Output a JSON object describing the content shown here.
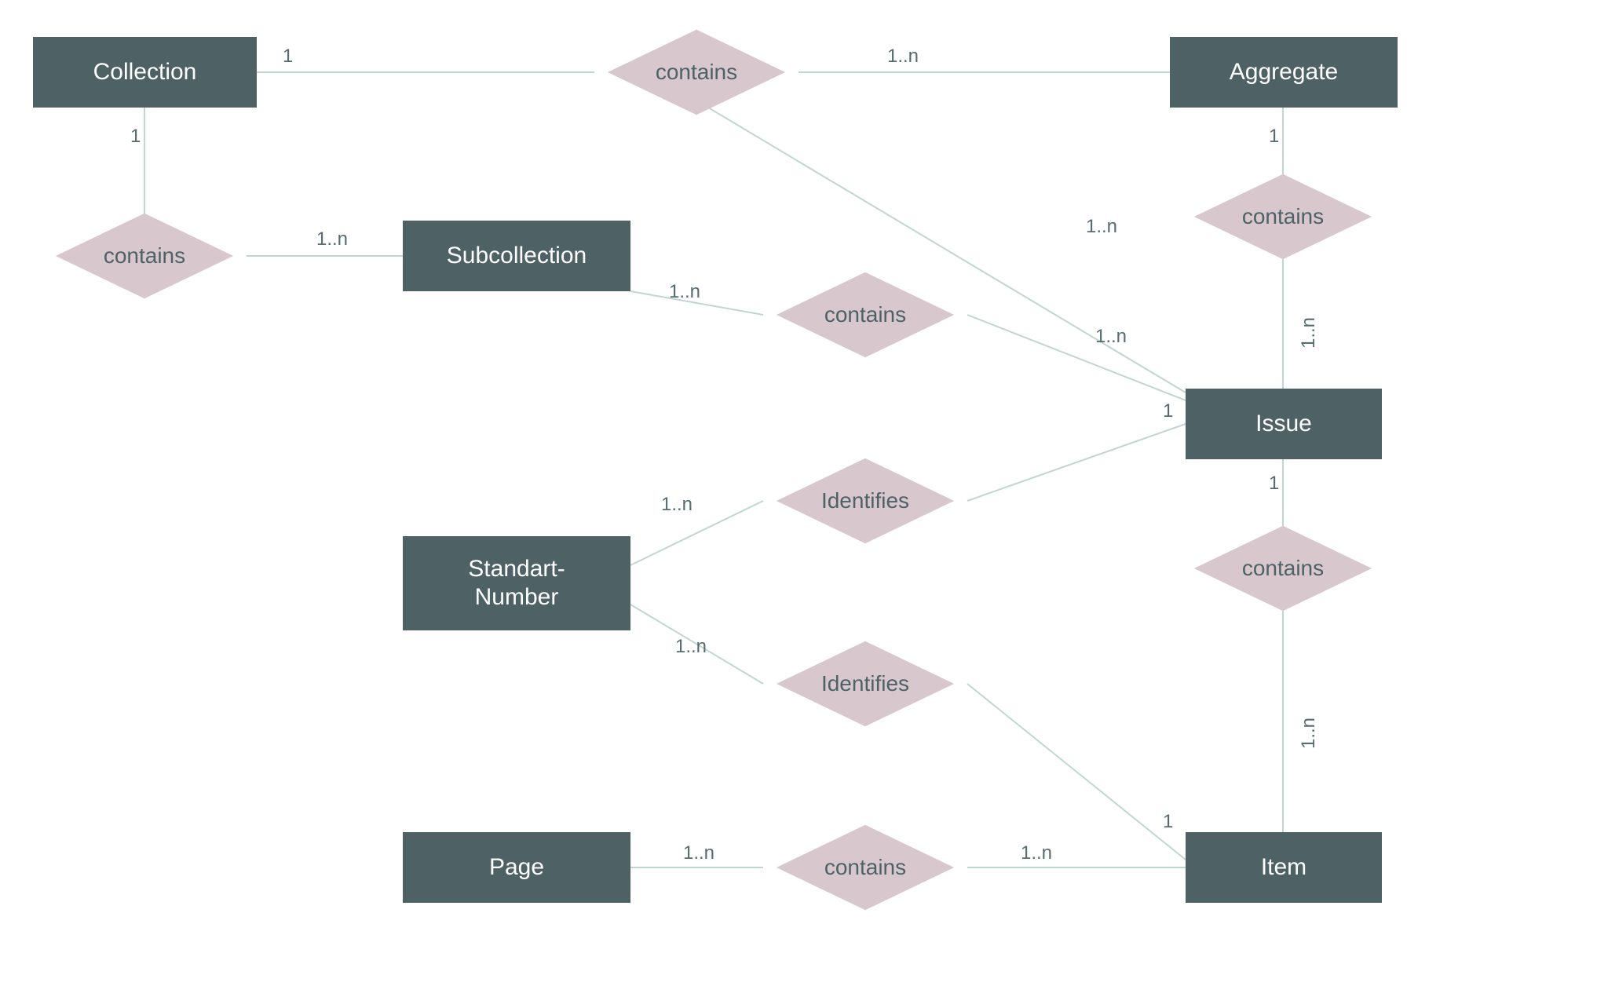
{
  "colors": {
    "entity_fill": "#4e6266",
    "entity_text": "#ffffff",
    "relationship_fill": "#d8c8ce",
    "relationship_text": "#4e6266",
    "edge_stroke": "#bfd6d1",
    "cardinality_text": "#576c70"
  },
  "entities": {
    "collection": "Collection",
    "subcollection": "Subcollection",
    "aggregate": "Aggregate",
    "issue": "Issue",
    "standart_number": "Standart-\nNumber",
    "item": "Item",
    "page": "Page"
  },
  "relationships": {
    "contains_top": "contains",
    "contains_left": "contains",
    "contains_sub_issue": "contains",
    "contains_agg_issue": "contains",
    "identifies_issue": "Identifies",
    "identifies_item": "Identifies",
    "contains_issue_item": "contains",
    "contains_page_item": "contains"
  },
  "cardinalities": {
    "coll_contains_top": "1",
    "contains_top_agg": "1..n",
    "coll_contains_left": "1",
    "contains_left_sub": "1..n",
    "contains_top_issue": "1..n",
    "sub_contains_sub_issue": "1..n",
    "contains_sub_issue_issue": "1..n",
    "agg_contains_agg_issue": "1",
    "contains_agg_issue_issue": "1..n",
    "issue_identifies_issue": "1",
    "std_identifies_issue": "1..n",
    "std_identifies_item": "1..n",
    "item_identifies_item": "1",
    "issue_contains_issue_item": "1",
    "contains_issue_item_item": "1..n",
    "page_contains_page_item": "1..n",
    "contains_page_item_item": "1..n"
  }
}
